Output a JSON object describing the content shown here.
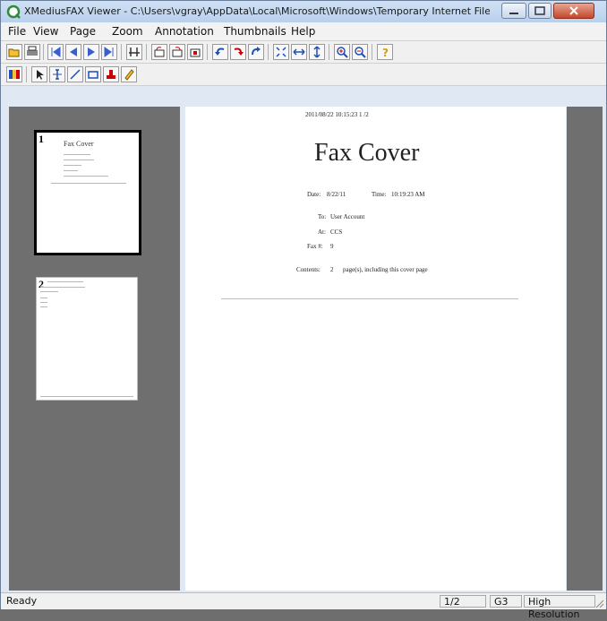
{
  "window": {
    "title": "XMediusFAX Viewer - C:\\Users\\vgray\\AppData\\Local\\Microsoft\\Windows\\Temporary Internet Files\\Co..."
  },
  "menu": {
    "items": [
      {
        "label": "File"
      },
      {
        "label": "View"
      },
      {
        "label": "Page"
      },
      {
        "label": "Zoom"
      },
      {
        "label": "Annotation"
      },
      {
        "label": "Thumbnails"
      },
      {
        "label": "Help"
      }
    ]
  },
  "thumbnails": [
    {
      "number": "1",
      "title": "Fax Cover"
    },
    {
      "number": "2",
      "title": ""
    }
  ],
  "document": {
    "header": "2011/08/22  10:15:23        1     /2",
    "title": "Fax Cover",
    "date_label": "Date:",
    "date_value": "8/22/11",
    "time_label": "Time:",
    "time_value": "10:19:23 AM",
    "to_label": "To:",
    "to_value": "User Account",
    "at_label": "At:",
    "at_value": "CCS",
    "fax_label": "Fax #:",
    "fax_value": "9",
    "contents_label": "Contents:",
    "contents_value": "2",
    "contents_suffix": "page(s), including this cover page"
  },
  "status": {
    "state": "Ready",
    "page": "1/2",
    "compression": "G3",
    "resolution": "High Resolution"
  },
  "colors": {
    "title_bar": "#c4d7ef",
    "close_button": "#c4482c",
    "pane_gray": "#6f6f6f"
  }
}
